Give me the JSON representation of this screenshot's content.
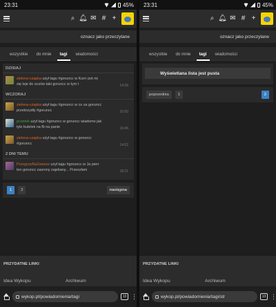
{
  "status": {
    "time": "23:31",
    "battery": "45%"
  },
  "app": {
    "logo_name": "wykop-logo",
    "icons": [
      "search-icon",
      "bell-icon",
      "mail-icon",
      "hashtag-icon",
      "plus-icon"
    ]
  },
  "mark_read": "oznacz jako przeczytane",
  "tabs": [
    "wszystkie",
    "do mnie",
    "tagi",
    "wiadomości"
  ],
  "active_tab": "tagi",
  "left": {
    "sections": [
      {
        "heading": "DZISIAJ",
        "items": [
          {
            "user": "zielona-czapka",
            "text": " użył tagu #goruncc w Kurrr pot mi się leje do oczów taki goruncc w tym t",
            "time": "14:36"
          }
        ]
      },
      {
        "heading": "WCZORAJ",
        "items": [
          {
            "user": "zielona-czapka",
            "text": " użył tagu #goruncc w co za goruncc przebrzydły #goruncc",
            "time": "20:50"
          },
          {
            "user": "pcomek",
            "text": " użył tagu #goruncc w goruncc wiadomo jak tyle butelek na fb na panie",
            "time": "19:46"
          },
          {
            "user": "zielona-czapka",
            "text": " użył tagu #goruncc w goruncc #goruncc",
            "time": "14:52"
          }
        ]
      },
      {
        "heading": "2 DNI TEMU",
        "items": [
          {
            "user": "PrzegrywNaZawsze",
            "text": " użył tagu #goruncc w Ja pierr ten goruncc zasrony zajebany... Przeszłam",
            "time": "18:21"
          }
        ]
      }
    ],
    "pager": {
      "pages": [
        "1",
        "2"
      ],
      "active": "1",
      "next": "następna"
    }
  },
  "right": {
    "empty_text": "Wyświetlana lista jest pusta",
    "pager": {
      "prev": "poprzednia",
      "pages": [
        "1",
        "2"
      ],
      "active": "2"
    }
  },
  "footer": {
    "heading": "PRZYDATNE LINKI",
    "links": [
      "Idea Wykopu",
      "Archiwum"
    ]
  },
  "browser": {
    "url_left": "wykop.pl/powiadomienia/tagi",
    "url_right": "wykop.pl/powiadomienia/tagi/str",
    "tab_count": "13"
  }
}
